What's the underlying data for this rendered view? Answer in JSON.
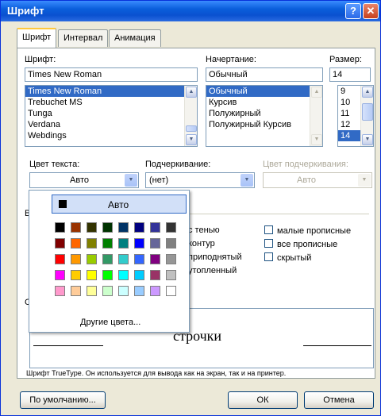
{
  "window": {
    "title": "Шрифт",
    "help_glyph": "?",
    "close_glyph": "✕"
  },
  "tabs": [
    "Шрифт",
    "Интервал",
    "Анимация"
  ],
  "font": {
    "label": "Шрифт:",
    "value": "Times New Roman",
    "list": [
      "Times New Roman",
      "Trebuchet MS",
      "Tunga",
      "Verdana",
      "Webdings"
    ],
    "selected_index": 0
  },
  "style": {
    "label": "Начертание:",
    "value": "Обычный",
    "list": [
      "Обычный",
      "Курсив",
      "Полужирный",
      "Полужирный Курсив"
    ],
    "selected_index": 0
  },
  "size": {
    "label": "Размер:",
    "value": "14",
    "list": [
      "9",
      "10",
      "11",
      "12",
      "14"
    ],
    "selected_index": 4
  },
  "text_color": {
    "label": "Цвет текста:",
    "value": "Авто"
  },
  "underline": {
    "label": "Подчеркивание:",
    "value": "(нет)"
  },
  "underline_color": {
    "label": "Цвет подчеркивания:",
    "value": "Авто"
  },
  "effects_group_letter": "В",
  "effects": [
    {
      "label": "с тенью"
    },
    {
      "label": "контур"
    },
    {
      "label": "приподнятый"
    },
    {
      "label": "утопленный"
    },
    {
      "label": "малые прописные"
    },
    {
      "label": "все прописные"
    },
    {
      "label": "скрытый"
    }
  ],
  "sample_group_letter": "О",
  "preview_text": "строчки",
  "info_text": "Шрифт TrueType. Он используется для вывода как на экран, так и на принтер.",
  "buttons": {
    "default": "По умолчанию...",
    "ok": "ОК",
    "cancel": "Отмена"
  },
  "color_picker": {
    "auto_label": "Авто",
    "more_colors": "Другие цвета...",
    "swatches": [
      [
        "#000000",
        "#993300",
        "#333300",
        "#003300",
        "#003366",
        "#000080",
        "#333399",
        "#333333"
      ],
      [
        "#800000",
        "#FF6600",
        "#808000",
        "#008000",
        "#008080",
        "#0000FF",
        "#666699",
        "#808080"
      ],
      [
        "#FF0000",
        "#FF9900",
        "#99CC00",
        "#339966",
        "#33CCCC",
        "#3366FF",
        "#800080",
        "#969696"
      ],
      [
        "#FF00FF",
        "#FFCC00",
        "#FFFF00",
        "#00FF00",
        "#00FFFF",
        "#00CCFF",
        "#993366",
        "#C0C0C0"
      ],
      [
        "#FF99CC",
        "#FFCC99",
        "#FFFF99",
        "#CCFFCC",
        "#CCFFFF",
        "#99CCFF",
        "#CC99FF",
        "#FFFFFF"
      ]
    ]
  }
}
